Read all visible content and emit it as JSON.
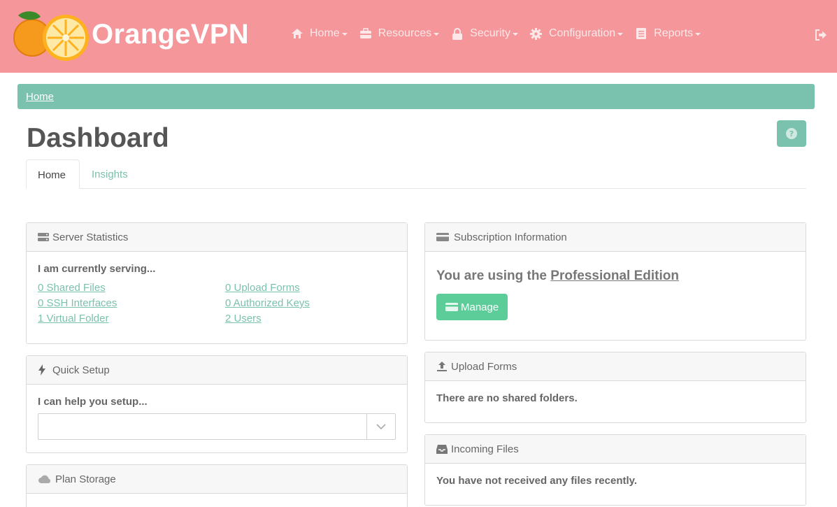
{
  "brand": {
    "name": "OrangeVPN"
  },
  "nav": [
    {
      "label": "Home",
      "icon": "home-icon"
    },
    {
      "label": "Resources",
      "icon": "resources-icon"
    },
    {
      "label": "Security",
      "icon": "lock-icon"
    },
    {
      "label": "Configuration",
      "icon": "gear-icon"
    },
    {
      "label": "Reports",
      "icon": "reports-icon"
    }
  ],
  "breadcrumb": {
    "home": "Home"
  },
  "page": {
    "title": "Dashboard"
  },
  "tabs": [
    {
      "label": "Home"
    },
    {
      "label": "Insights"
    }
  ],
  "server_stats": {
    "title": "Server Statistics",
    "intro": "I am currently serving...",
    "links": [
      "0 Shared Files",
      "0 Upload Forms",
      "0 SSH Interfaces",
      "0 Authorized Keys",
      "1 Virtual Folder",
      "2 Users"
    ]
  },
  "quick_setup": {
    "title": "Quick Setup",
    "intro": "I can help you setup...",
    "select_value": ""
  },
  "plan_storage": {
    "title": "Plan Storage"
  },
  "subscription": {
    "title": "Subscription Information",
    "text_prefix": "You are using the ",
    "edition": "Professional Edition",
    "manage_label": "Manage"
  },
  "upload_forms": {
    "title": "Upload Forms",
    "text": "There are no shared folders."
  },
  "incoming_files": {
    "title": "Incoming Files",
    "text": "You have not received any files recently."
  },
  "colors": {
    "navbar": "#f4969a",
    "accent": "#7ac2ad",
    "button": "#5ccc99"
  }
}
